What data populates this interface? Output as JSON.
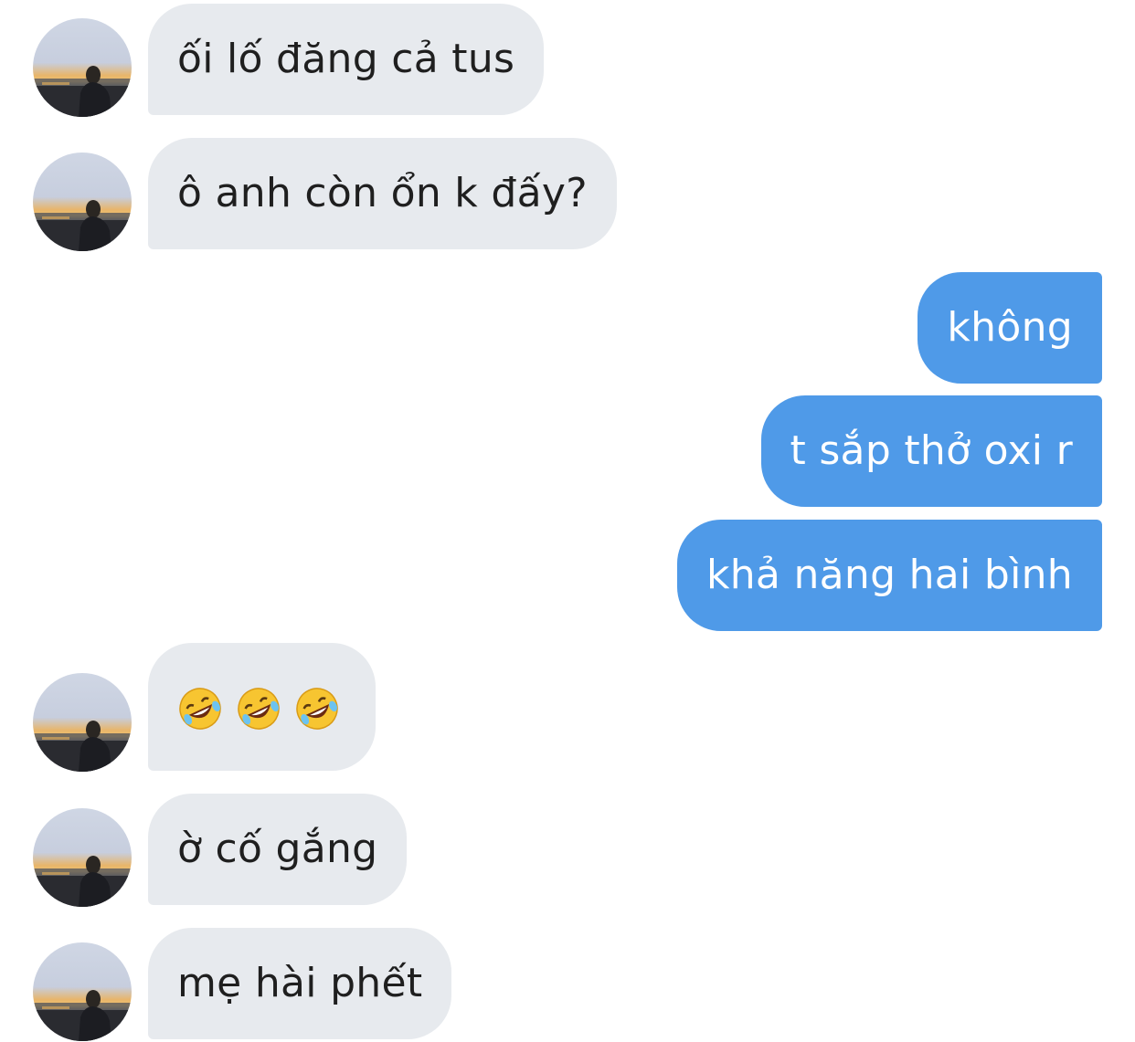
{
  "conversation": {
    "messages": [
      {
        "direction": "incoming",
        "text": "ối lố đăng cả tus"
      },
      {
        "direction": "incoming",
        "text": "ô anh còn ổn k đấy?"
      },
      {
        "direction": "outgoing",
        "text": "không"
      },
      {
        "direction": "outgoing",
        "text": "t sắp thở oxi r"
      },
      {
        "direction": "outgoing",
        "text": "khả năng hai bình"
      },
      {
        "direction": "incoming",
        "text": "🤣🤣🤣",
        "emoji": [
          "rolling-on-floor-laughing",
          "rolling-on-floor-laughing",
          "rolling-on-floor-laughing"
        ]
      },
      {
        "direction": "incoming",
        "text": "ờ cố gắng"
      },
      {
        "direction": "incoming",
        "text": "mẹ hài phết"
      }
    ]
  },
  "colors": {
    "incoming_bubble": "#e7eaee",
    "outgoing_bubble": "#4f9ae8",
    "incoming_text": "#1f1f1f",
    "outgoing_text": "#ffffff"
  }
}
